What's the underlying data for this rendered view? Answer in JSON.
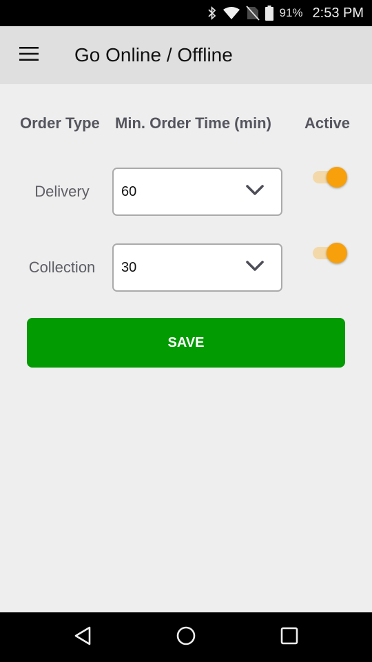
{
  "status_bar": {
    "icons": [
      "bluetooth-icon",
      "wifi-icon",
      "no-sim-icon",
      "battery-icon"
    ],
    "battery_percent": "91%",
    "time": "2:53 PM"
  },
  "app_bar": {
    "menu_icon": "hamburger-menu-icon",
    "title": "Go Online / Offline"
  },
  "table": {
    "headers": {
      "order_type": "Order Type",
      "min_order_time": "Min. Order Time (min)",
      "active": "Active"
    },
    "rows": [
      {
        "label": "Delivery",
        "min_order_time": "60",
        "active": true
      },
      {
        "label": "Collection",
        "min_order_time": "30",
        "active": true
      }
    ]
  },
  "save_button": {
    "label": "SAVE"
  },
  "colors": {
    "accent_green": "#029b02",
    "toggle_on": "#f7a00c",
    "toggle_track_on": "#f3d9a9",
    "header_text": "#55555f"
  },
  "nav_bar": {
    "buttons": [
      "back-icon",
      "home-icon",
      "recents-icon"
    ]
  }
}
